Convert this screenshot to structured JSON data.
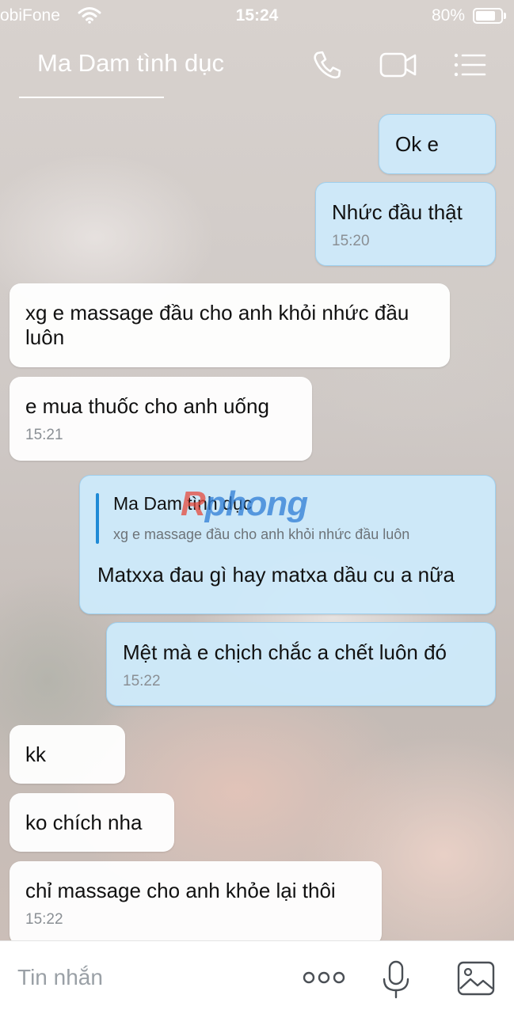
{
  "status": {
    "carrier": "obiFone",
    "time": "15:24",
    "battery": "80%",
    "battery_level": 0.8
  },
  "header": {
    "title": "Ma Dam tình dục",
    "icons": [
      "phone-icon",
      "video-camera-icon",
      "menu-icon"
    ]
  },
  "messages": {
    "m1": {
      "direction": "out",
      "text": "Ok e"
    },
    "m2": {
      "direction": "out",
      "text": "Nhức đầu thật",
      "time": "15:20"
    },
    "m3": {
      "direction": "in",
      "line1": "xg e massage đầu cho anh khỏi nhức đầu",
      "line2": "luôn"
    },
    "m4": {
      "direction": "in",
      "text": "e mua thuốc cho anh uống",
      "time": "15:21"
    },
    "m5": {
      "direction": "out",
      "quote_name": "Ma Dam tình dục",
      "quote_text": "xg e massage đầu cho anh khỏi nhức đầu luôn",
      "text": "Matxxa đau gì hay matxa dầu cu a nữa"
    },
    "m6": {
      "direction": "out",
      "text": "Mệt mà e chịch chắc a chết luôn đó",
      "time": "15:22"
    },
    "m7": {
      "direction": "in",
      "text": "kk"
    },
    "m8": {
      "direction": "in",
      "text": "ko chích nha"
    },
    "m9": {
      "direction": "in",
      "text": "chỉ massage cho anh khỏe lại thôi",
      "time": "15:22"
    }
  },
  "watermark": {
    "first": "R",
    "rest": "phong"
  },
  "input": {
    "placeholder": "Tin nhắn",
    "icons": [
      "more-icon",
      "microphone-icon",
      "image-icon"
    ]
  },
  "colors": {
    "outgoing_bubble": "#cde9fa",
    "incoming_bubble": "#ffffff",
    "accent": "#1f8ad6"
  }
}
